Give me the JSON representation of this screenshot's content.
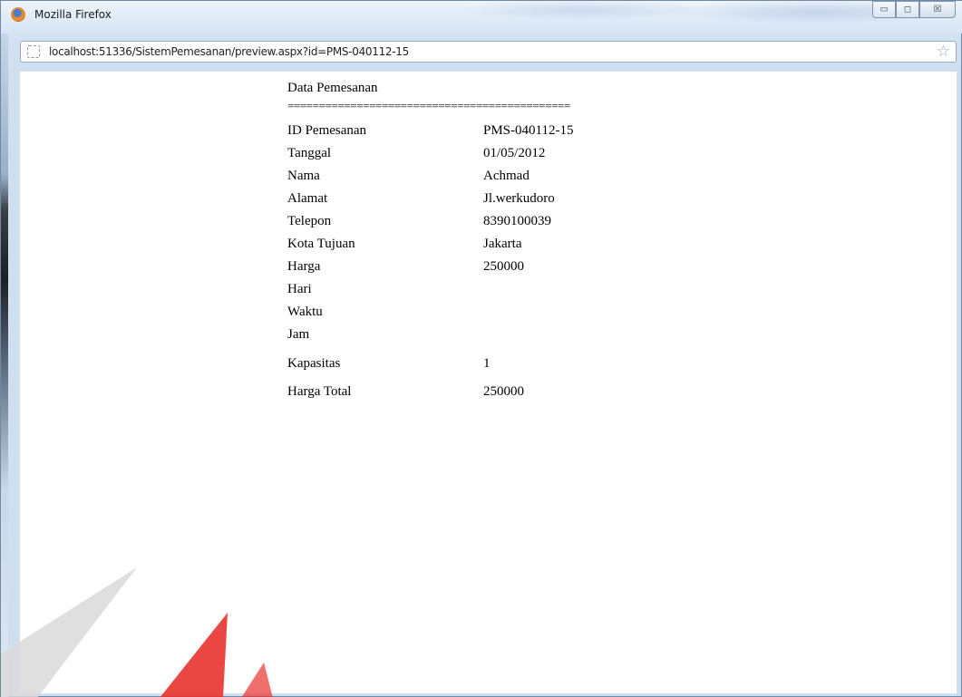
{
  "window": {
    "title": "Mozilla Firefox",
    "controls": {
      "minimize": "▭",
      "maximize": "◻",
      "close": "☒"
    }
  },
  "address_bar": {
    "url": "localhost:51336/SistemPemesanan/preview.aspx?id=PMS-040112-15"
  },
  "document": {
    "heading": "Data Pemesanan",
    "separator": "=============================================",
    "rows": [
      {
        "label": "ID Pemesanan",
        "value": "PMS-040112-15"
      },
      {
        "label": "Tanggal",
        "value": "01/05/2012"
      },
      {
        "label": "Nama",
        "value": "Achmad"
      },
      {
        "label": "Alamat",
        "value": "Jl.werkudoro"
      },
      {
        "label": "Telepon",
        "value": "8390100039"
      },
      {
        "label": "Kota Tujuan",
        "value": "Jakarta"
      },
      {
        "label": "Harga",
        "value": "250000"
      },
      {
        "label": "Hari",
        "value": ""
      },
      {
        "label": "Waktu",
        "value": ""
      },
      {
        "label": "Jam",
        "value": ""
      },
      {
        "label": "Kapasitas",
        "value": "1"
      },
      {
        "label": "Harga Total",
        "value": "250000"
      }
    ]
  },
  "icons": {
    "app": "firefox-icon",
    "site": "site-identity-icon",
    "bookmark": "bookmark-star-icon"
  },
  "colors": {
    "window_frame": "#dbe8f6",
    "watermark_red": "#e8322d",
    "watermark_grey": "#d9d9d9"
  }
}
